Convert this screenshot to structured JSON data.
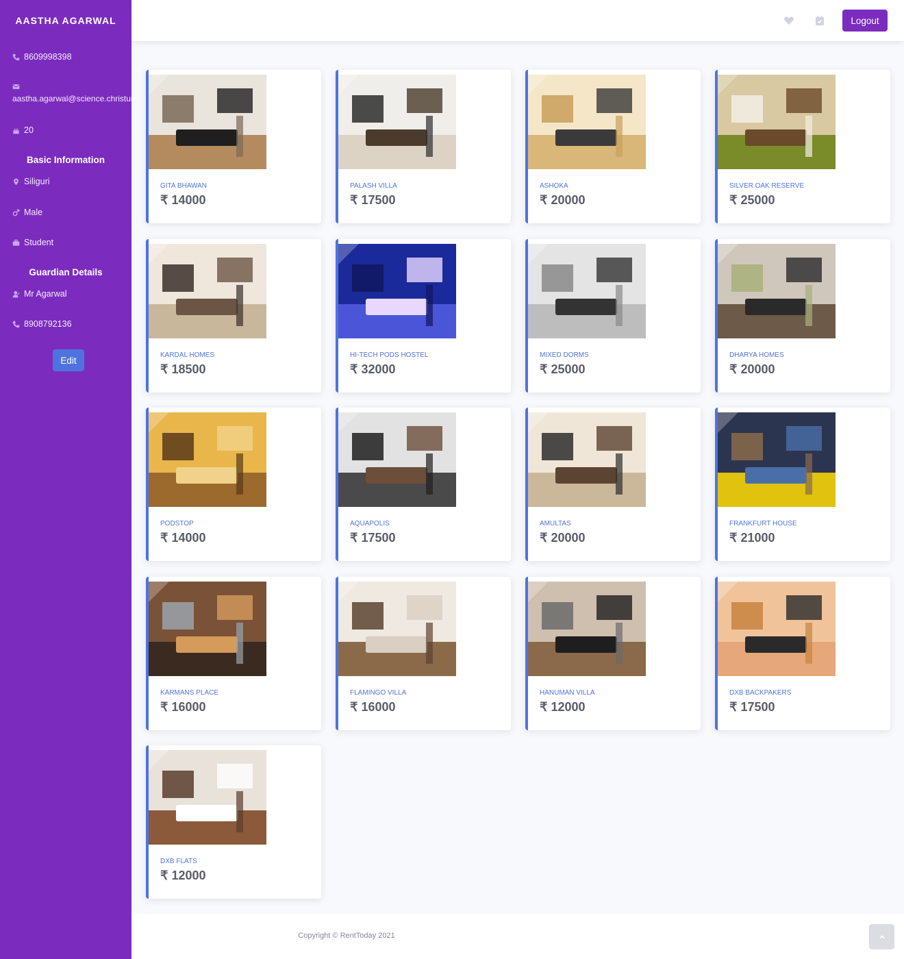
{
  "profile": {
    "name": "AASTHA AGARWAL",
    "phone": "8609998398",
    "email": "aastha.agarwal@science.christuniversity.in",
    "age": "20",
    "basic_heading": "Basic Information",
    "city": "Siliguri",
    "gender": "Male",
    "occupation": "Student",
    "guardian_heading": "Guardian Details",
    "guardian_name": "Mr Agarwal",
    "guardian_phone": "8908792136",
    "edit_label": "Edit"
  },
  "topbar": {
    "logout_label": "Logout",
    "icons": [
      "heart-icon",
      "calendar-icon"
    ]
  },
  "colors": {
    "sidebar": "#7b2cbf",
    "accent": "#4e73df",
    "page_bg": "#f8f9fc"
  },
  "listings": [
    {
      "name": "GITA BHAWAN",
      "price": "₹ 14000",
      "scene": "living"
    },
    {
      "name": "PALASH VILLA",
      "price": "₹ 17500",
      "scene": "bright-living"
    },
    {
      "name": "ASHOKA",
      "price": "₹ 20000",
      "scene": "warm-living"
    },
    {
      "name": "SILVER OAK RESERVE",
      "price": "₹ 25000",
      "scene": "bedroom-green"
    },
    {
      "name": "KARDAL HOMES",
      "price": "₹ 18500",
      "scene": "bedroom-cream"
    },
    {
      "name": "HI-TECH PODS HOSTEL",
      "price": "₹ 32000",
      "scene": "pod"
    },
    {
      "name": "MIXED DORMS",
      "price": "₹ 25000",
      "scene": "dorm-grey"
    },
    {
      "name": "DHARYA HOMES",
      "price": "₹ 20000",
      "scene": "dorm-brown"
    },
    {
      "name": "PODSTOP",
      "price": "₹ 14000",
      "scene": "lobby-yellow"
    },
    {
      "name": "AQUAPOLIS",
      "price": "₹ 17500",
      "scene": "kitchen-dark"
    },
    {
      "name": "AMULTAS",
      "price": "₹ 20000",
      "scene": "hall-beige"
    },
    {
      "name": "FRANKFURT HOUSE",
      "price": "₹ 21000",
      "scene": "lounge-colorful"
    },
    {
      "name": "KARMANS PLACE",
      "price": "₹ 16000",
      "scene": "kitchen-wood"
    },
    {
      "name": "FLAMINGO VILLA",
      "price": "₹ 16000",
      "scene": "bedroom-wood"
    },
    {
      "name": "HANUMAN VILLA",
      "price": "₹ 12000",
      "scene": "tv-room"
    },
    {
      "name": "DXB BACKPAKERS",
      "price": "₹ 17500",
      "scene": "cafe-peach"
    },
    {
      "name": "DXB FLATS",
      "price": "₹ 12000",
      "scene": "twin-bedroom"
    }
  ],
  "footer": {
    "copyright": "Copyright © RentToday 2021"
  }
}
